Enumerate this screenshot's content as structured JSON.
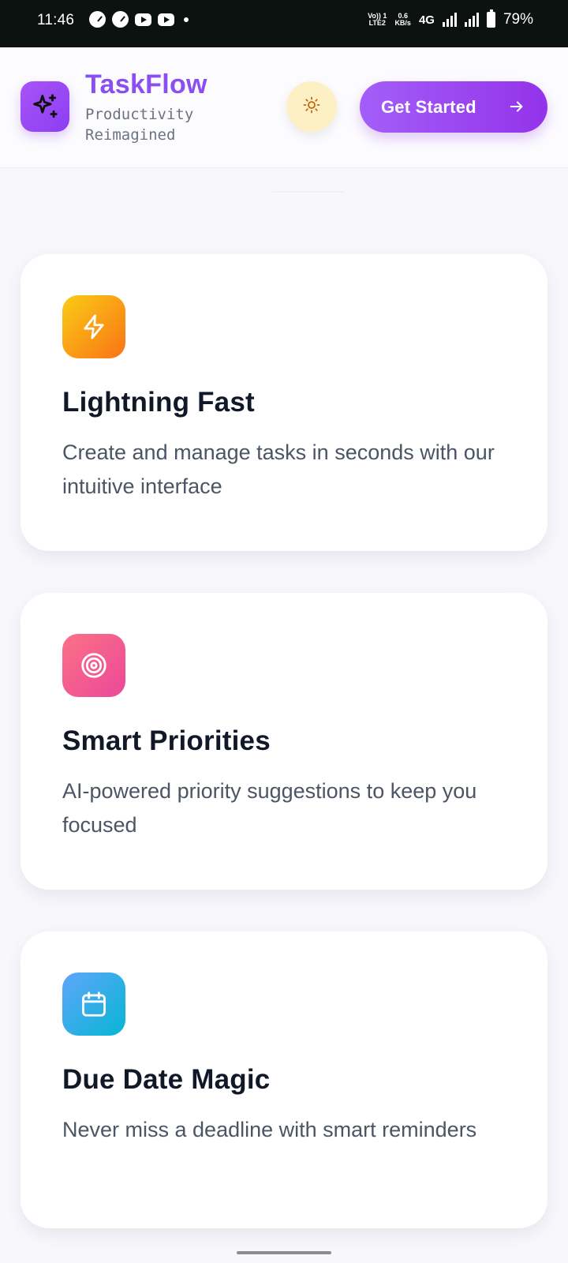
{
  "status_bar": {
    "time": "11:46",
    "network_top": "Vo)) 1",
    "network_bottom": "LTE2",
    "speed_top": "0.6",
    "speed_bottom": "KB/s",
    "network_type": "4G",
    "battery": "79%"
  },
  "header": {
    "app_name": "TaskFlow",
    "tagline": "Productivity Reimagined",
    "cta_label": "Get Started",
    "brand_color": "#8b4ef0"
  },
  "features": [
    {
      "title": "Lightning Fast",
      "description": "Create and manage tasks in seconds with our intuitive interface",
      "icon": "lightning-icon",
      "gradient": [
        "#facc15",
        "#f97316"
      ]
    },
    {
      "title": "Smart Priorities",
      "description": "AI-powered priority suggestions to keep you focused",
      "icon": "target-icon",
      "gradient": [
        "#fb7185",
        "#ec4899"
      ]
    },
    {
      "title": "Due Date Magic",
      "description": "Never miss a deadline with smart reminders",
      "icon": "calendar-icon",
      "gradient": [
        "#60a5fa",
        "#06b6d4"
      ]
    }
  ]
}
